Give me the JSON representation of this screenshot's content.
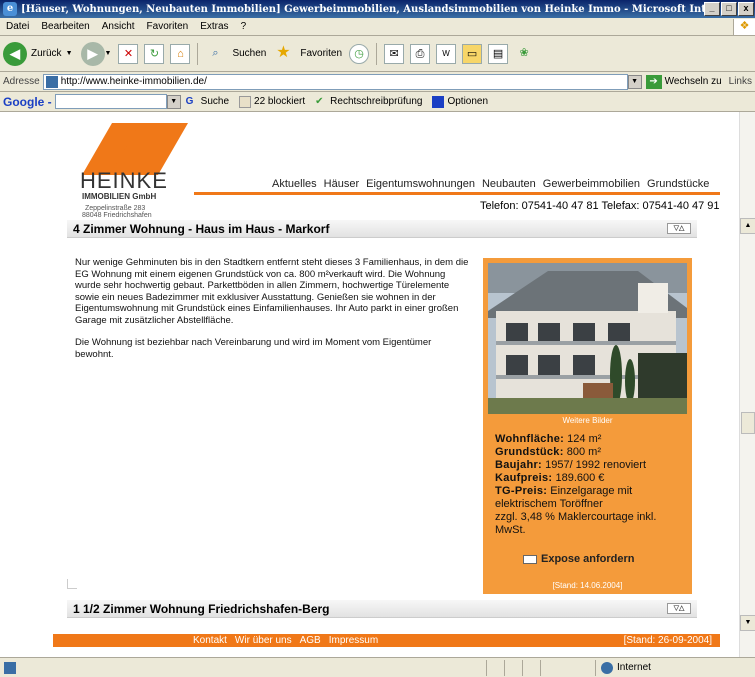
{
  "window": {
    "title": "[Häuser, Wohnungen, Neubauten Immobilien] Gewerbeimmobilien, Auslandsimmobilien von Heinke Immo - Microsoft Internet Explorer",
    "buttons": [
      "_",
      "□",
      "x"
    ]
  },
  "menu": [
    "Datei",
    "Bearbeiten",
    "Ansicht",
    "Favoriten",
    "Extras",
    "?"
  ],
  "toolbar": {
    "back_label": "Zurück",
    "search_label": "Suchen",
    "favorites_label": "Favoriten"
  },
  "address": {
    "label": "Adresse",
    "url": "http://www.heinke-immobilien.de/",
    "go_label": "Wechseln zu",
    "links_label": "Links"
  },
  "googlebar": {
    "logo": "Google -",
    "search_label": "Suche",
    "blocked": "22 blockiert",
    "spell": "Rechtschreibprüfung",
    "options": "Optionen"
  },
  "site": {
    "logo_name": "HEINKE",
    "logo_sub": "IMMOBILIEN GmbH",
    "street": "Zeppelinstraße 283",
    "city": "88048 Friedrichshafen",
    "nav": [
      "Aktuelles",
      "Häuser",
      "Eigentumswohnungen",
      "Neubauten",
      "Gewerbeimmobilien",
      "Grundstücke"
    ],
    "contact": "Telefon: 07541-40 47 81  Telefax: 07541-40 47 91"
  },
  "listing1": {
    "title": "4 Zimmer Wohnung - Haus im Haus - Markorf",
    "para1": "Nur wenige Gehminuten bis in den Stadtkern entfernt steht dieses 3 Familienhaus, in dem die EG Wohnung mit einem eigenen Grundstück von ca. 800 m²verkauft wird. Die Wohnung wurde sehr hochwertig gebaut. Parkettböden in allen Zimmern, hochwertige Türelemente sowie ein neues Badezimmer mit exklusiver Ausstattung. Genießen sie wohnen in der Eigentumswohnung mit Grundstück eines Einfamilienhauses. Ihr Auto parkt in einer großen Garage mit zusätzlicher Abstellfläche.",
    "para2": "Die Wohnung ist beziehbar nach Vereinbarung und wird im Moment vom Eigentümer bewohnt.",
    "more_pics": "Weitere Bilder",
    "facts": {
      "wohnflaeche_label": "Wohnfläche:",
      "wohnflaeche": "124  m²",
      "grundstueck_label": "Grundstück:",
      "grundstueck": "800 m²",
      "baujahr_label": "Baujahr:",
      "baujahr": "1957/ 1992 renoviert",
      "kaufpreis_label": "Kaufpreis:",
      "kaufpreis": "189.600 €",
      "tg_label": "TG-Preis:",
      "tg": "Einzelgarage mit elektrischem Toröffner",
      "courtage": "zzgl. 3,48 % Maklercourtage inkl. MwSt."
    },
    "expose": "Expose anfordern",
    "stand": "[Stand: 14.06.2004]"
  },
  "listing2": {
    "title": "1 1/2 Zimmer Wohnung Friedrichshafen-Berg"
  },
  "footer": {
    "links": [
      "Kontakt",
      "Wir über uns",
      "AGB",
      "Impressum"
    ],
    "stand": "[Stand: 26-09-2004]"
  },
  "status": {
    "zone": "Internet"
  }
}
